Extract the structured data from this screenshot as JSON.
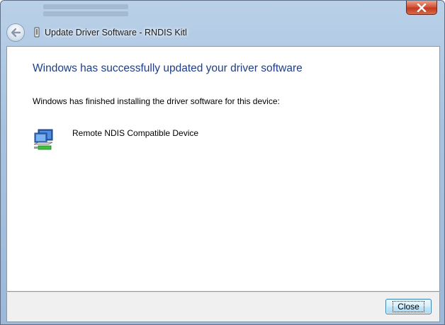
{
  "window": {
    "title": "Update Driver Software - RNDIS Kitl"
  },
  "content": {
    "heading": "Windows has successfully updated your driver software",
    "description": "Windows has finished installing the driver software for this device:",
    "device_name": "Remote NDIS Compatible Device",
    "device_icon": "network-adapter-icon"
  },
  "footer": {
    "close_label": "Close"
  },
  "colors": {
    "heading": "#1e3e86",
    "close_x": "#c23b1f",
    "button_border": "#3c7fb1"
  }
}
